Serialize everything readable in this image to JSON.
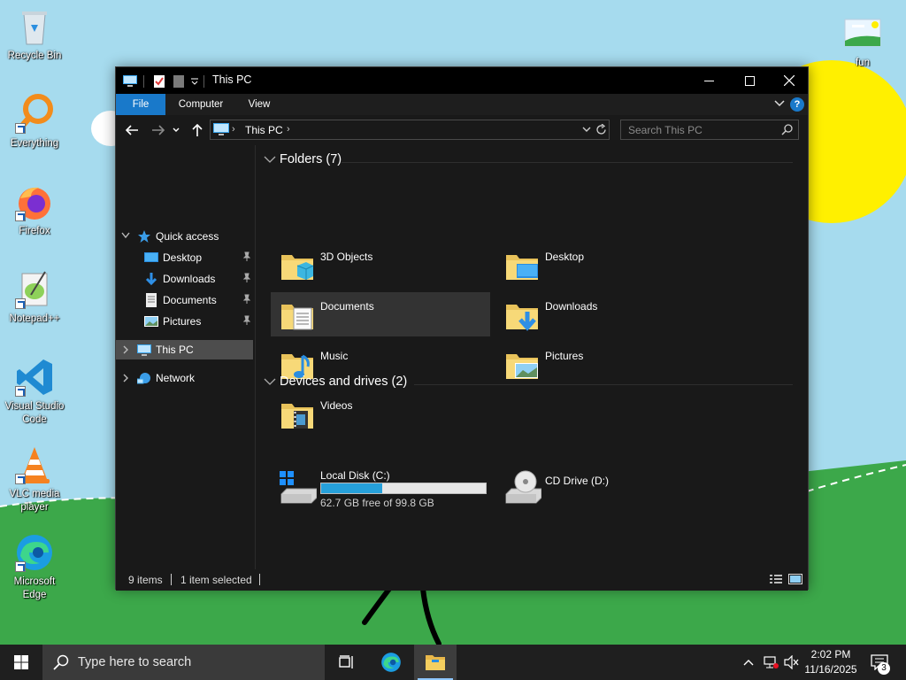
{
  "desktop": {
    "icons": [
      {
        "label": "Recycle Bin",
        "icon": "recycle-bin-icon"
      },
      {
        "label": "Everything",
        "icon": "everything-search-icon"
      },
      {
        "label": "Firefox",
        "icon": "firefox-icon"
      },
      {
        "label": "Notepad++",
        "icon": "notepad-plus-plus-icon"
      },
      {
        "label": "Visual Studio Code",
        "icon": "vscode-icon"
      },
      {
        "label": "VLC media player",
        "icon": "vlc-icon"
      },
      {
        "label": "Microsoft Edge",
        "icon": "edge-icon"
      },
      {
        "label": "fun",
        "icon": "image-file-icon"
      }
    ]
  },
  "window": {
    "title": "This PC",
    "ribbon_tabs": [
      "File",
      "Computer",
      "View"
    ],
    "address": {
      "crumb": "This PC"
    },
    "search": {
      "placeholder": "Search This PC"
    },
    "nav": {
      "quick_access": "Quick access",
      "pinned": [
        "Desktop",
        "Downloads",
        "Documents",
        "Pictures"
      ],
      "this_pc": "This PC",
      "network": "Network"
    },
    "groups": {
      "folders": {
        "header": "Folders (7)",
        "items": [
          "3D Objects",
          "Desktop",
          "Documents",
          "Downloads",
          "Music",
          "Pictures",
          "Videos"
        ]
      },
      "devices": {
        "header": "Devices and drives (2)",
        "local_disk": {
          "name": "Local Disk (C:)",
          "free_text": "62.7 GB free of 99.8 GB",
          "used_fraction": 0.372
        },
        "cd_drive": {
          "name": "CD Drive (D:)"
        }
      }
    },
    "status": {
      "items": "9 items",
      "selected": "1 item selected"
    }
  },
  "taskbar": {
    "search_placeholder": "Type here to search",
    "time": "2:02 PM",
    "date": "11/16/2025",
    "notification_count": "3"
  },
  "colors": {
    "accent": "#1979ca",
    "sky": "#a3d9ea",
    "grass": "#34a853",
    "sun": "#ffee00"
  }
}
